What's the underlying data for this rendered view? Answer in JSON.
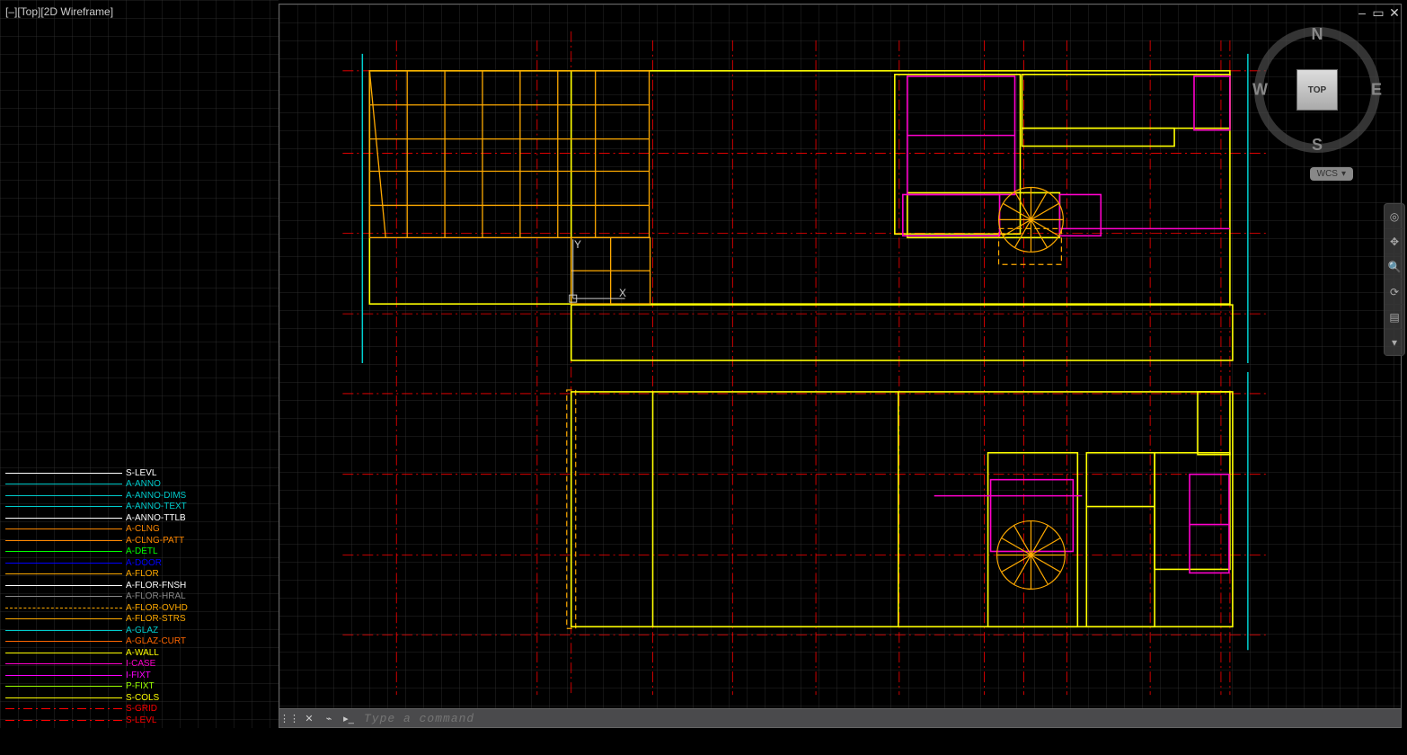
{
  "viewport": {
    "label": "[–][Top][2D Wireframe]"
  },
  "window_controls": {
    "minimize": "–",
    "maximize": "▭",
    "close": "✕"
  },
  "viewcube": {
    "n": "N",
    "s": "S",
    "e": "E",
    "w": "W",
    "top": "TOP",
    "wcs": "WCS"
  },
  "axes": {
    "x": "X",
    "y": "Y"
  },
  "command_bar": {
    "placeholder": "Type a command"
  },
  "layers": [
    {
      "name": "S-LEVL",
      "color": "#ffffff",
      "style": "solid"
    },
    {
      "name": "A-ANNO",
      "color": "#00cccc",
      "style": "solid"
    },
    {
      "name": "A-ANNO-DIMS",
      "color": "#00cccc",
      "style": "solid"
    },
    {
      "name": "A-ANNO-TEXT",
      "color": "#00cccc",
      "style": "solid"
    },
    {
      "name": "A-ANNO-TTLB",
      "color": "#ffffff",
      "style": "solid"
    },
    {
      "name": "A-CLNG",
      "color": "#ff8800",
      "style": "solid"
    },
    {
      "name": "A-CLNG-PATT",
      "color": "#ff8800",
      "style": "solid"
    },
    {
      "name": "A-DETL",
      "color": "#00ff00",
      "style": "solid"
    },
    {
      "name": "A-DOOR",
      "color": "#0000ff",
      "style": "solid"
    },
    {
      "name": "A-FLOR",
      "color": "#ffaa00",
      "style": "solid"
    },
    {
      "name": "A-FLOR-FNSH",
      "color": "#ffffff",
      "style": "solid"
    },
    {
      "name": "A-FLOR-HRAL",
      "color": "#888888",
      "style": "solid"
    },
    {
      "name": "A-FLOR-OVHD",
      "color": "#ffaa00",
      "style": "dashed"
    },
    {
      "name": "A-FLOR-STRS",
      "color": "#ffaa00",
      "style": "solid"
    },
    {
      "name": "A-GLAZ",
      "color": "#00cccc",
      "style": "solid"
    },
    {
      "name": "A-GLAZ-CURT",
      "color": "#ff6600",
      "style": "solid"
    },
    {
      "name": "A-WALL",
      "color": "#ffff00",
      "style": "solid"
    },
    {
      "name": "I-CASE",
      "color": "#ff00cc",
      "style": "solid"
    },
    {
      "name": "I-FIXT",
      "color": "#ff00ff",
      "style": "solid"
    },
    {
      "name": "P-FIXT",
      "color": "#99ff00",
      "style": "solid"
    },
    {
      "name": "S-COLS",
      "color": "#ffff00",
      "style": "solid"
    },
    {
      "name": "S-GRID",
      "color": "#ff0000",
      "style": "dashdot"
    },
    {
      "name": "S-LEVL",
      "color": "#ff0000",
      "style": "dashdot"
    }
  ]
}
